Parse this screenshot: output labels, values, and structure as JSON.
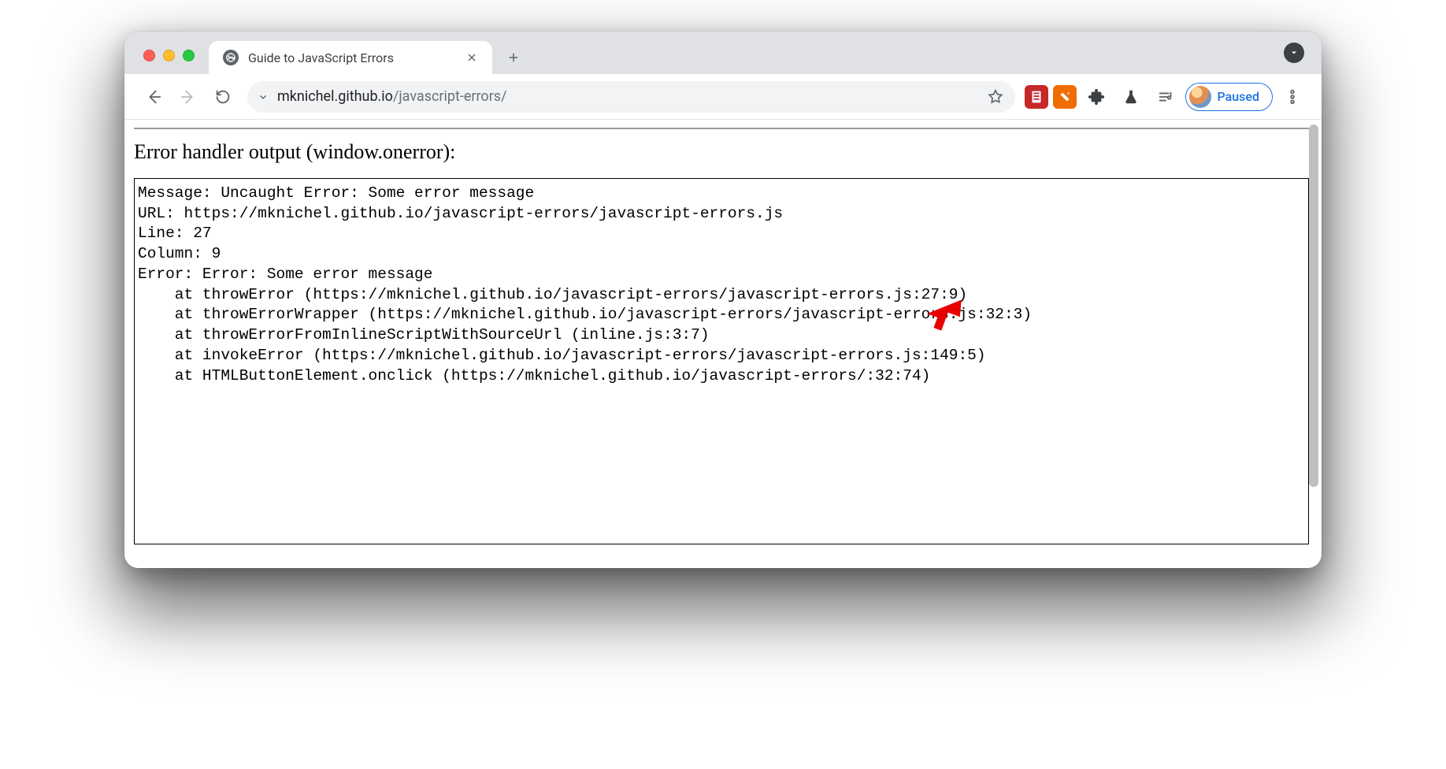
{
  "tab": {
    "title": "Guide to JavaScript Errors"
  },
  "url": {
    "host": "mknichel.github.io",
    "path": "/javascript-errors/"
  },
  "profile": {
    "status": "Paused"
  },
  "page": {
    "heading": "Error handler output (window.onerror):",
    "output": "Message: Uncaught Error: Some error message\nURL: https://mknichel.github.io/javascript-errors/javascript-errors.js\nLine: 27\nColumn: 9\nError: Error: Some error message\n    at throwError (https://mknichel.github.io/javascript-errors/javascript-errors.js:27:9)\n    at throwErrorWrapper (https://mknichel.github.io/javascript-errors/javascript-errors.js:32:3)\n    at throwErrorFromInlineScriptWithSourceUrl (inline.js:3:7)\n    at invokeError (https://mknichel.github.io/javascript-errors/javascript-errors.js:149:5)\n    at HTMLButtonElement.onclick (https://mknichel.github.io/javascript-errors/:32:74)"
  }
}
